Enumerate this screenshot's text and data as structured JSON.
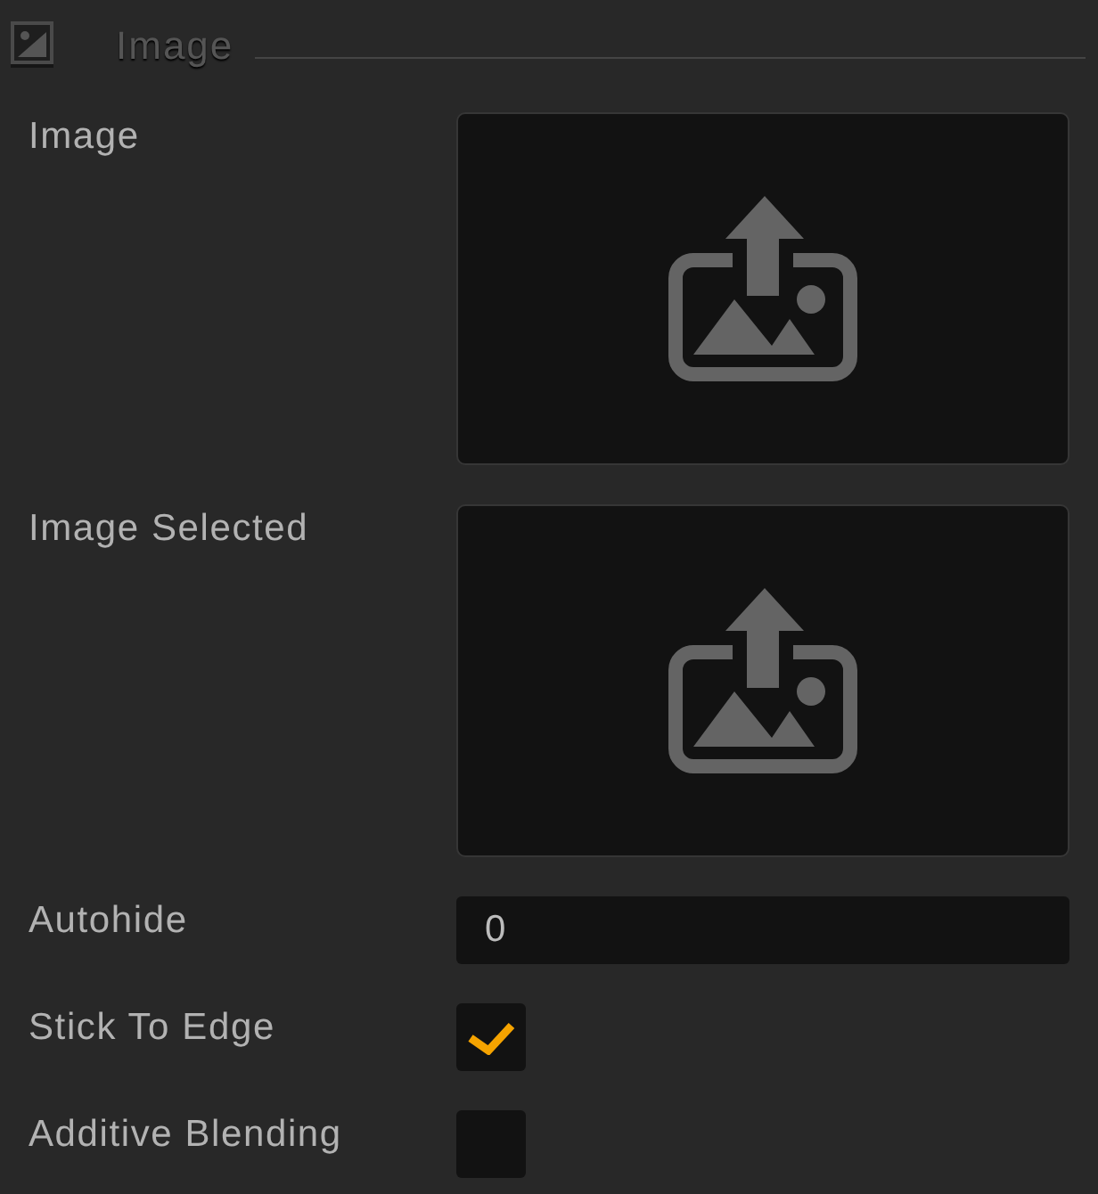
{
  "section": {
    "title": "Image"
  },
  "fields": [
    {
      "kind": "image",
      "label": "Image"
    },
    {
      "kind": "image",
      "label": "Image Selected"
    },
    {
      "kind": "number",
      "label": "Autohide",
      "value": "0"
    },
    {
      "kind": "checkbox",
      "label": "Stick To Edge",
      "checked": true
    },
    {
      "kind": "checkbox",
      "label": "Additive Blending",
      "checked": false
    }
  ]
}
